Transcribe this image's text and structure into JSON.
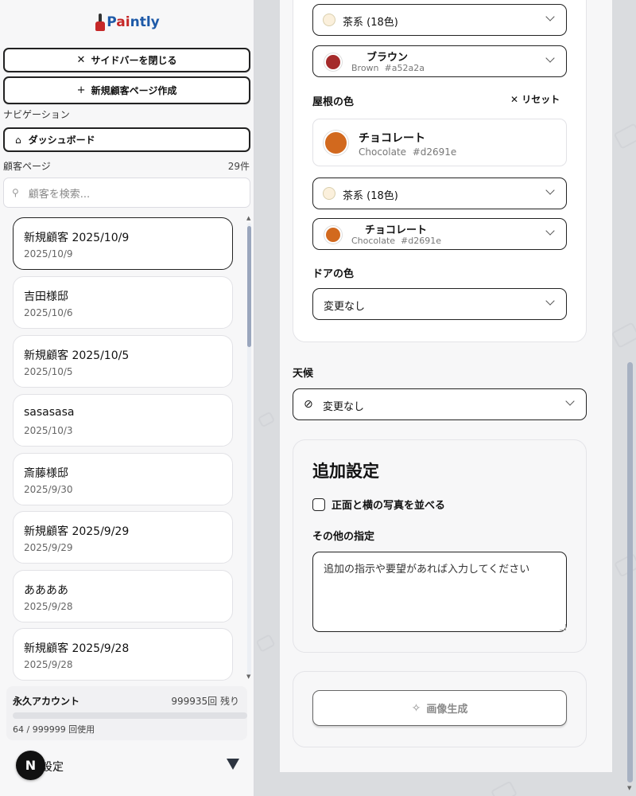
{
  "app": {
    "logo_prefix": "P",
    "logo_accent": "ai",
    "logo_suffix": "ntly"
  },
  "sidebar": {
    "close_button": "サイドバーを閉じる",
    "new_page_button": "新規顧客ページ作成",
    "nav_label": "ナビゲーション",
    "dashboard_label": "ダッシュボード",
    "customers_label": "顧客ページ",
    "customers_count": "29件",
    "search_placeholder": "顧客を検索...",
    "customers": [
      {
        "name": "新規顧客 2025/10/9",
        "date": "2025/10/9",
        "active": true
      },
      {
        "name": "吉田様邸",
        "date": "2025/10/6"
      },
      {
        "name": "新規顧客 2025/10/5",
        "date": "2025/10/5"
      },
      {
        "name": "sasasasa",
        "date": "2025/10/3"
      },
      {
        "name": "斎藤様邸",
        "date": "2025/9/30"
      },
      {
        "name": "新規顧客 2025/9/29",
        "date": "2025/9/29"
      },
      {
        "name": "ああああ",
        "date": "2025/9/28"
      },
      {
        "name": "新規顧客 2025/9/28",
        "date": "2025/9/28"
      }
    ],
    "account": {
      "label": "永久アカウント",
      "remaining": "999935回 残り",
      "usage": "64 / 999999 回使用",
      "usage_fraction": 6.4e-05
    },
    "settings_label": "設定",
    "avatar_letter": "N"
  },
  "main": {
    "wall_family_select": "茶系 (18色)",
    "wall_color": {
      "name": "ブラウン",
      "en": "Brown",
      "hex": "#a52a2a"
    },
    "roof_label": "屋根の色",
    "roof_reset": "リセット",
    "roof_preview": {
      "name": "チョコレート",
      "en": "Chocolate",
      "hex": "#d2691e"
    },
    "roof_family_select": "茶系 (18色)",
    "roof_color": {
      "name": "チョコレート",
      "en": "Chocolate",
      "hex": "#d2691e"
    },
    "family_swatch_hex": "#fbf0dc",
    "door_label": "ドアの色",
    "door_select": "変更なし",
    "weather_label": "天候",
    "weather_select": "変更なし",
    "extra_title": "追加設定",
    "side_by_side_label": "正面と横の写真を並べる",
    "other_label": "その他の指定",
    "notes_placeholder": "追加の指示や要望があれば入力してください",
    "generate_button": "画像生成"
  },
  "icons": {
    "close": "x-icon",
    "plus": "plus-icon",
    "home": "home-icon",
    "search": "search-icon",
    "chevron": "chevron-down-icon",
    "weather": "circle-slash-icon",
    "sparkle": "sparkle-icon"
  }
}
